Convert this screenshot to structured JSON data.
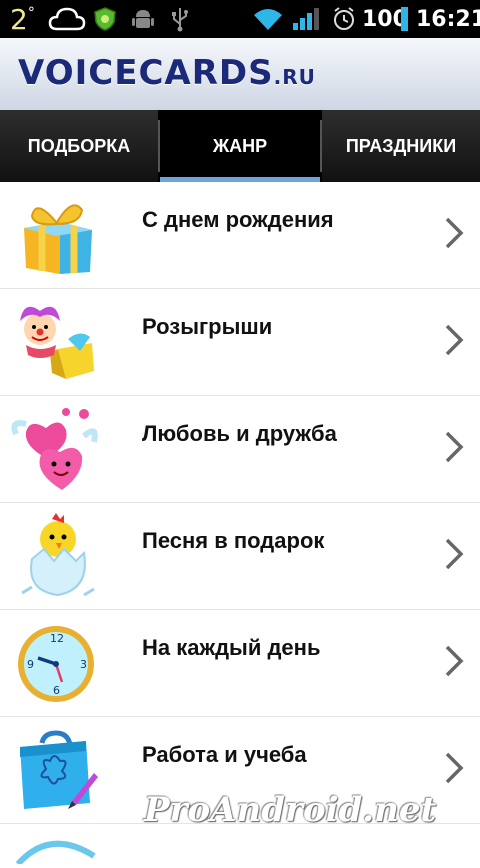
{
  "status_bar": {
    "temperature": "2",
    "degree": "°",
    "battery": "100",
    "time": "16:21",
    "icons": [
      "cloud-icon",
      "security-icon",
      "android-icon",
      "usb-icon",
      "wifi-icon",
      "signal-icon",
      "alarm-icon",
      "battery-icon"
    ]
  },
  "header": {
    "logo": "VOICECARDS",
    "logo_domain": ".RU"
  },
  "tabs": [
    {
      "label": "ПОДБОРКА",
      "active": false
    },
    {
      "label": "ЖАНР",
      "active": true
    },
    {
      "label": "ПРАЗДНИКИ",
      "active": false
    }
  ],
  "categories": [
    {
      "label": "С днем рождения",
      "icon": "gift-icon"
    },
    {
      "label": "Розыгрыши",
      "icon": "jester-box-icon"
    },
    {
      "label": "Любовь и дружба",
      "icon": "hearts-icon"
    },
    {
      "label": "Песня в подарок",
      "icon": "chick-egg-icon"
    },
    {
      "label": "На каждый день",
      "icon": "clock-icon"
    },
    {
      "label": "Работа и учеба",
      "icon": "briefcase-icon"
    }
  ],
  "watermark": "ProAndroid.net",
  "colors": {
    "tab_indicator": "#6fa3e0",
    "logo": "#1b2a78"
  }
}
